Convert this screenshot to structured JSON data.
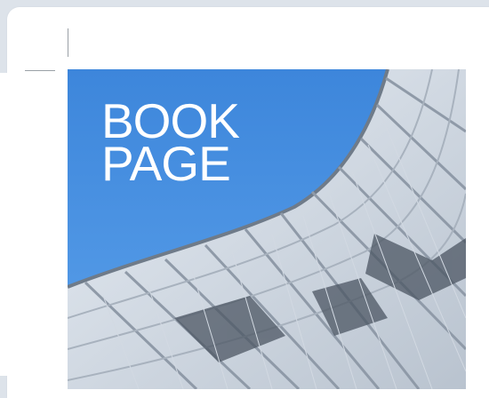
{
  "cover": {
    "title_line1": "BOOK",
    "title_line2": "PAGE"
  },
  "colors": {
    "sky": "#4a90e2",
    "page_background": "#dde3ea"
  }
}
